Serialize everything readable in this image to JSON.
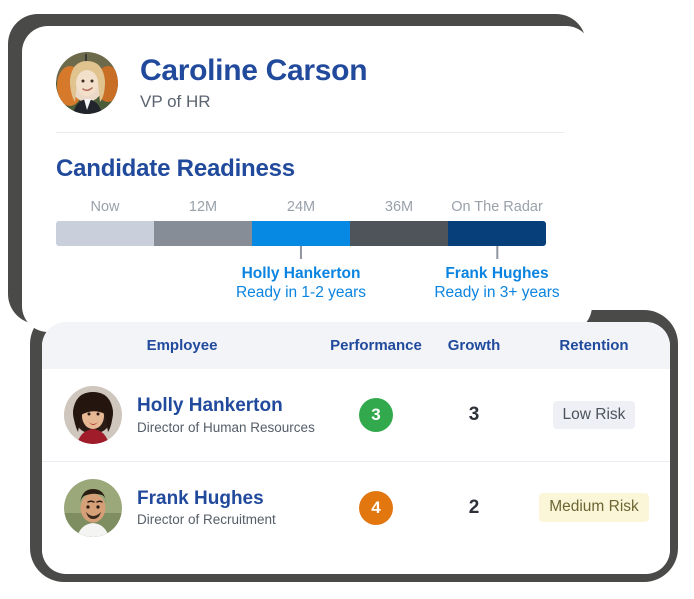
{
  "profile": {
    "name": "Caroline Carson",
    "role": "VP of HR",
    "avatar_icon": "avatar-photo-caroline"
  },
  "readiness": {
    "section_title": "Candidate Readiness",
    "tick_labels": [
      "Now",
      "12M",
      "24M",
      "36M",
      "On The Radar"
    ],
    "segment_colors": [
      "#c9cfdb",
      "#868d96",
      "#0689e2",
      "#4f545b",
      "#063f79"
    ],
    "markers": [
      {
        "name": "Holly Hankerton",
        "subtitle": "Ready in 1-2 years",
        "position_pct": 50
      },
      {
        "name": "Frank Hughes",
        "subtitle": "Ready in 3+ years",
        "position_pct": 90
      }
    ]
  },
  "table": {
    "columns": [
      "Employee",
      "Performance",
      "Growth",
      "Retention"
    ],
    "rows": [
      {
        "name": "Holly Hankerton",
        "title": "Director of Human Resources",
        "performance": "3",
        "performance_color": "#32a94c",
        "growth": "3",
        "retention": "Low Risk",
        "retention_bg": "#eef0f5",
        "retention_fg": "#4c535d",
        "avatar_icon": "avatar-photo-holly"
      },
      {
        "name": "Frank Hughes",
        "title": "Director of Recruitment",
        "performance": "4",
        "performance_color": "#e2760f",
        "growth": "2",
        "retention": "Medium Risk",
        "retention_bg": "#fbf6d8",
        "retention_fg": "#6e6533",
        "avatar_icon": "avatar-photo-frank"
      }
    ]
  },
  "colors": {
    "brand_navy": "#214a9c",
    "bright_blue": "#0a84e0",
    "card_shadow": "#4a4a48"
  }
}
